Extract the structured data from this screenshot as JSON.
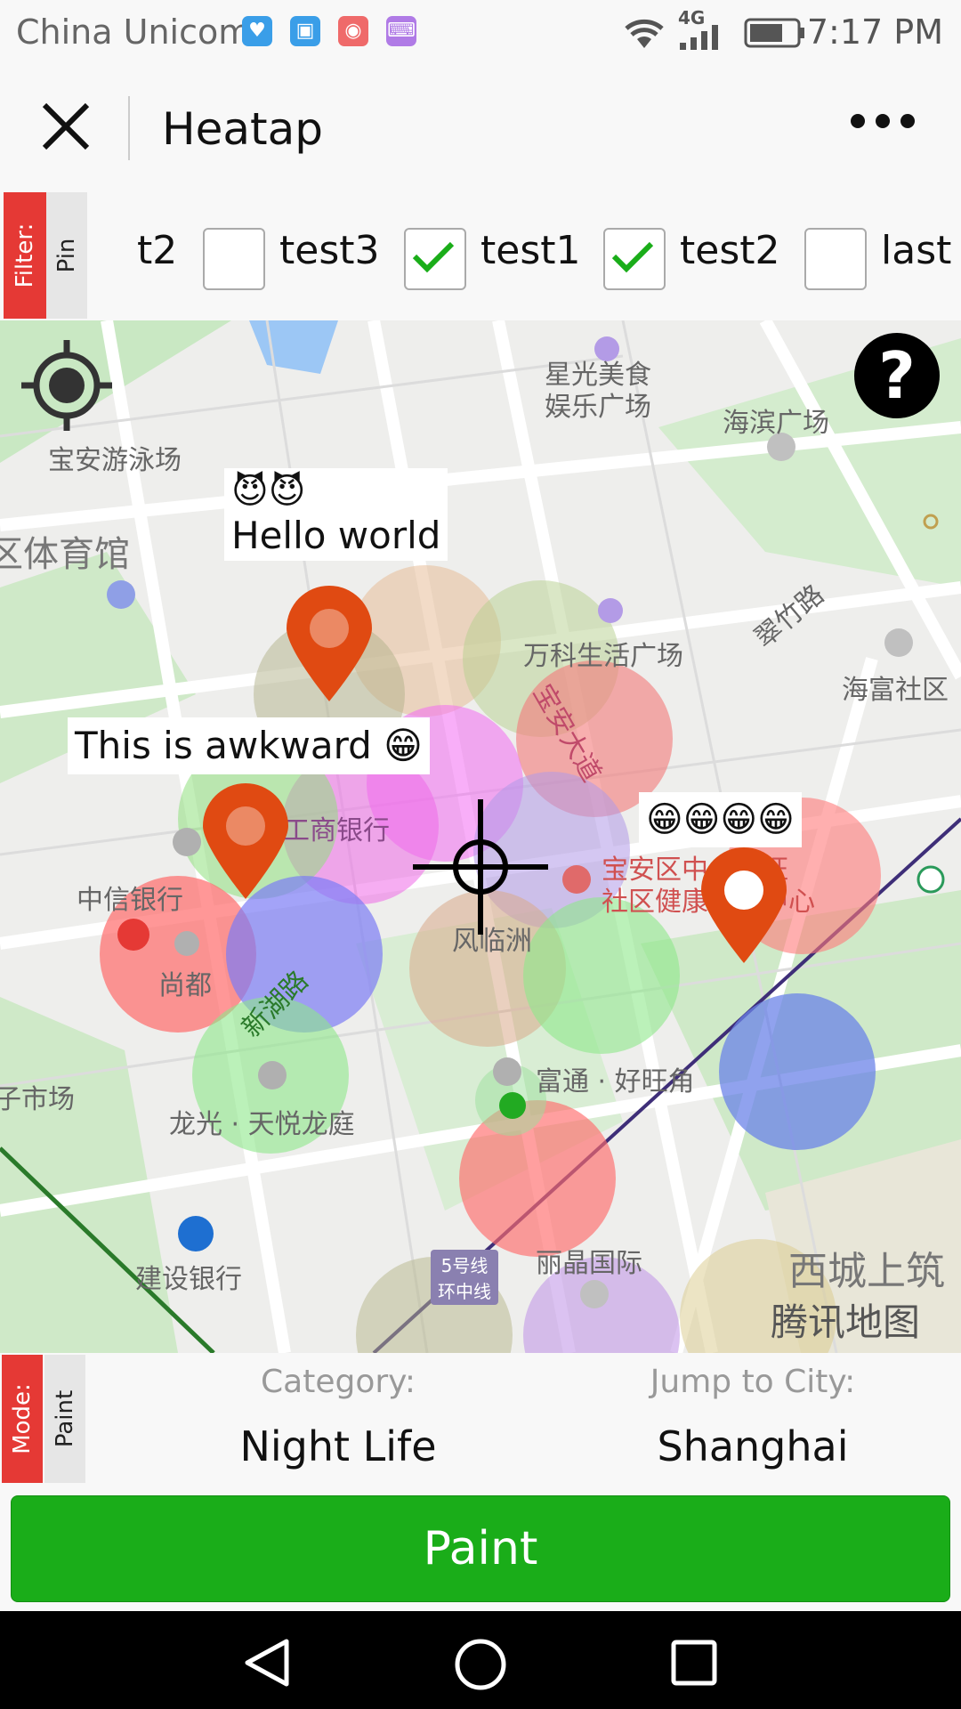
{
  "status_bar": {
    "carrier": "China Unicom",
    "network": "4G",
    "time": "7:17 PM"
  },
  "title_bar": {
    "title": "Heatap"
  },
  "filter_bar": {
    "filter_tab": "Filter:",
    "pin_tab": "Pin",
    "items": [
      {
        "label": "t2",
        "checked": null
      },
      {
        "label": "test3",
        "checked": false
      },
      {
        "label": "test1",
        "checked": true
      },
      {
        "label": "test2",
        "checked": true
      },
      {
        "label": "last",
        "checked": false
      }
    ]
  },
  "map": {
    "popups": {
      "hello": {
        "emoji": "😈😈",
        "text": "Hello world"
      },
      "awkward": "This is awkward 😁",
      "laugh": "😁😁😁😁"
    },
    "poi_labels": {
      "xingguang1": "星光美食",
      "xingguang2": "娱乐广场",
      "haibin": "海滨广场",
      "swim": "宝安游泳场",
      "tiyuguan": "区体育馆",
      "wanke": "万科生活广场",
      "cuizhu": "翠竹路",
      "haifu": "海富社区",
      "gongshang": "工商银行",
      "zhongxin": "中信银行",
      "shangdu": "尚都",
      "baoan_center1": "宝安区中心海旺",
      "baoan_center2": "社区健康服务中心",
      "fenglin": "风临洲",
      "futong": "富通 · 好旺角",
      "longguang": "龙光 · 天悦龙庭",
      "shichang": "子市场",
      "jianshe": "建设银行",
      "line5a": "5号线",
      "line5b": "环中线",
      "lijing": "丽晶国际",
      "xicheng": "西城上筑",
      "watermark": "腾讯地图",
      "baoan_road": "宝安大道",
      "xinan_road": "新湖路",
      "pinglan_road": "路"
    },
    "help_glyph": "?"
  },
  "mode_bar": {
    "mode_tab": "Mode:",
    "paint_tab": "Paint",
    "category_label": "Category:",
    "category_value": "Night Life",
    "city_label": "Jump to City:",
    "city_value": "Shanghai"
  },
  "paint_button": "Paint",
  "colors": {
    "accent_green": "#1aad19",
    "tab_red": "#e53935",
    "pin_orange": "#e04a12"
  }
}
